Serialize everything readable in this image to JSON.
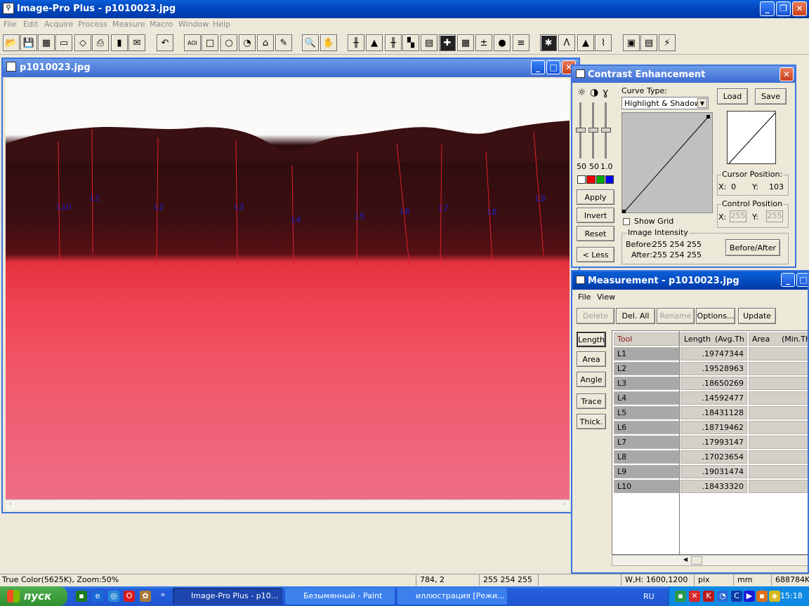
{
  "app": {
    "title": "Image-Pro Plus - p1010023.jpg"
  },
  "menu": [
    "File",
    "Edit",
    "Acquire",
    "Process",
    "Measure",
    "Macro",
    "Window",
    "Help"
  ],
  "image_window": {
    "title": "p1010023.jpg",
    "lines": [
      {
        "label": "L10"
      },
      {
        "label": "L1"
      },
      {
        "label": "L2"
      },
      {
        "label": "L3"
      },
      {
        "label": "L4"
      },
      {
        "label": "L5"
      },
      {
        "label": "L6"
      },
      {
        "label": "L7"
      },
      {
        "label": "L8"
      },
      {
        "label": "L9"
      }
    ]
  },
  "contrast": {
    "title": "Contrast Enhancement",
    "curve_type_label": "Curve Type:",
    "curve_type_value": "Highlight & Shadow",
    "slider_values": [
      "50",
      "50",
      "1.0"
    ],
    "buttons": {
      "load": "Load",
      "save": "Save",
      "apply": "Apply",
      "invert": "Invert",
      "reset": "Reset",
      "less": "< Less",
      "before_after": "Before/After"
    },
    "show_grid": "Show Grid",
    "cursor_position": {
      "label": "Cursor Position:",
      "x_label": "X:",
      "x": "0",
      "y_label": "Y:",
      "y": "103"
    },
    "control_position": {
      "label": "Control Position",
      "x_label": "X:",
      "x": "255",
      "y_label": "Y:",
      "y": "255"
    },
    "image_intensity": {
      "label": "Image Intensity",
      "before_label": "Before:",
      "before": "255  254  255",
      "after_label": "After:",
      "after": "255  254  255"
    }
  },
  "measurement": {
    "title": "Measurement - p1010023.jpg",
    "menu": [
      "File",
      "View"
    ],
    "buttons": {
      "delete": "Delete",
      "del_all": "Del. All",
      "rename": "Rename",
      "options": "Options...",
      "update": "Update"
    },
    "tools": [
      "Length",
      "Area",
      "Angle",
      "Trace",
      "Thick."
    ],
    "columns": [
      "Tool",
      "Length",
      "(Avg.Th",
      "Area",
      "(Min.Thi"
    ],
    "rows": [
      {
        "tool": "L1",
        "length": ".19747344"
      },
      {
        "tool": "L2",
        "length": ".19528963"
      },
      {
        "tool": "L3",
        "length": ".18650269"
      },
      {
        "tool": "L4",
        "length": ".14592477"
      },
      {
        "tool": "L5",
        "length": ".18431128"
      },
      {
        "tool": "L6",
        "length": ".18719462"
      },
      {
        "tool": "L7",
        "length": ".17993147"
      },
      {
        "tool": "L8",
        "length": ".17023654"
      },
      {
        "tool": "L9",
        "length": ".19031474"
      },
      {
        "tool": "L10",
        "length": ".18433320"
      }
    ]
  },
  "status": {
    "mode": "True Color(5625K), Zoom:50%",
    "coords": "784,   2",
    "rgb": "255 254 255",
    "wh": "W,H: 1600,1200",
    "unit1": "pix",
    "unit2": "mm",
    "mem": "688784K"
  },
  "taskbar": {
    "start": "пуск",
    "tasks": [
      "Image-Pro Plus - p10...",
      "Безымянный - Paint",
      "иллюстрация [Режи..."
    ],
    "lang": "RU",
    "clock": "15:18"
  }
}
